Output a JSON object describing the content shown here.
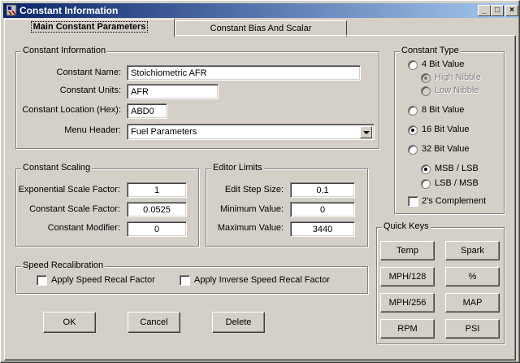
{
  "window": {
    "title": "Constant Information",
    "controls": {
      "minimize": "_",
      "maximize": "□",
      "close": "×"
    }
  },
  "tabs": [
    {
      "label": "Main Constant Parameters",
      "active": true
    },
    {
      "label": "Constant Bias And Scalar",
      "active": false
    }
  ],
  "constant_info": {
    "group_label": "Constant Information",
    "name_label": "Constant Name:",
    "name_value": "Stoichiometric AFR",
    "units_label": "Constant Units:",
    "units_value": "AFR",
    "location_label": "Constant Location (Hex):",
    "location_value": "ABD0",
    "menu_label": "Menu Header:",
    "menu_value": "Fuel Parameters"
  },
  "scaling": {
    "group_label": "Constant Scaling",
    "exp_label": "Exponential Scale Factor:",
    "exp_value": "1",
    "scale_label": "Constant Scale Factor:",
    "scale_value": "0.0525",
    "modifier_label": "Constant Modifier:",
    "modifier_value": "0"
  },
  "limits": {
    "group_label": "Editor Limits",
    "step_label": "Edit Step Size:",
    "step_value": "0.1",
    "min_label": "Minimum Value:",
    "min_value": "0",
    "max_label": "Maximum Value:",
    "max_value": "3440"
  },
  "speed": {
    "group_label": "Speed Recalibration",
    "apply_label": "Apply Speed Recal Factor",
    "apply_checked": false,
    "inverse_label": "Apply Inverse Speed Recal Factor",
    "inverse_checked": false
  },
  "constant_type": {
    "group_label": "Constant Type",
    "options": [
      {
        "label": "4 Bit Value",
        "selected": false
      },
      {
        "label": "High Nibble",
        "selected": true,
        "disabled": true
      },
      {
        "label": "Low Nibble",
        "selected": false,
        "disabled": true
      },
      {
        "label": "8 Bit Value",
        "selected": false
      },
      {
        "label": "16 Bit Value",
        "selected": true
      },
      {
        "label": "32 Bit Value",
        "selected": false
      },
      {
        "label": "MSB / LSB",
        "selected": true
      },
      {
        "label": "LSB / MSB",
        "selected": false
      }
    ],
    "twos_label": "2's Complement",
    "twos_checked": false
  },
  "quick_keys": {
    "group_label": "Quick Keys",
    "keys": [
      "Temp",
      "Spark",
      "MPH/128",
      "%",
      "MPH/256",
      "MAP",
      "RPM",
      "PSI"
    ]
  },
  "buttons": {
    "ok": "OK",
    "cancel": "Cancel",
    "delete": "Delete"
  },
  "colors": {
    "title_start": "#0a246a",
    "title_end": "#a6caf0",
    "face": "#d4d0c8"
  }
}
